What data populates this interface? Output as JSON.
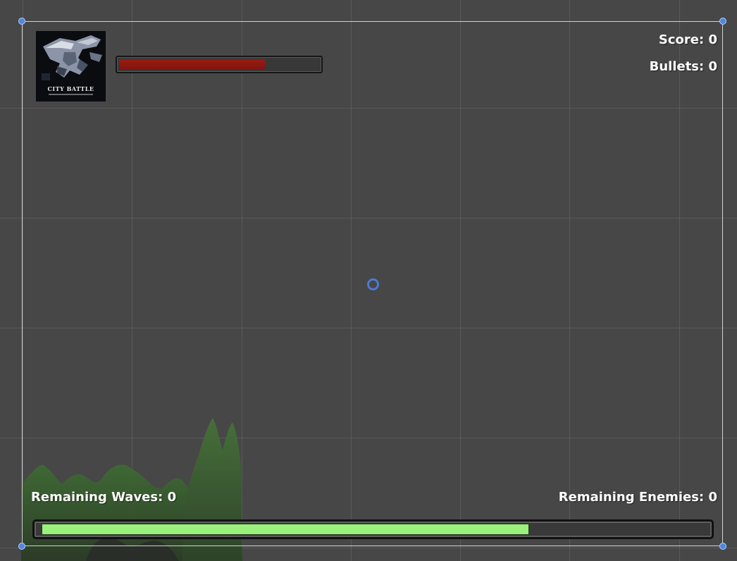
{
  "hud": {
    "score_label": "Score: 0",
    "bullets_label": "Bullets: 0",
    "remaining_waves_label": "Remaining Waves: 0",
    "remaining_enemies_label": "Remaining Enemies: 0"
  },
  "health_bar": {
    "fill_fraction": 0.73,
    "color": "#8c1a12"
  },
  "wave_progress": {
    "fill_fraction": 0.735,
    "color": "#9af27d"
  },
  "logo": {
    "title": "CITY BATTLE",
    "icon": "soldier-mech-icon"
  },
  "colors": {
    "background": "#474747",
    "handle": "#4f86e0",
    "terrain": "#3d5a32"
  }
}
